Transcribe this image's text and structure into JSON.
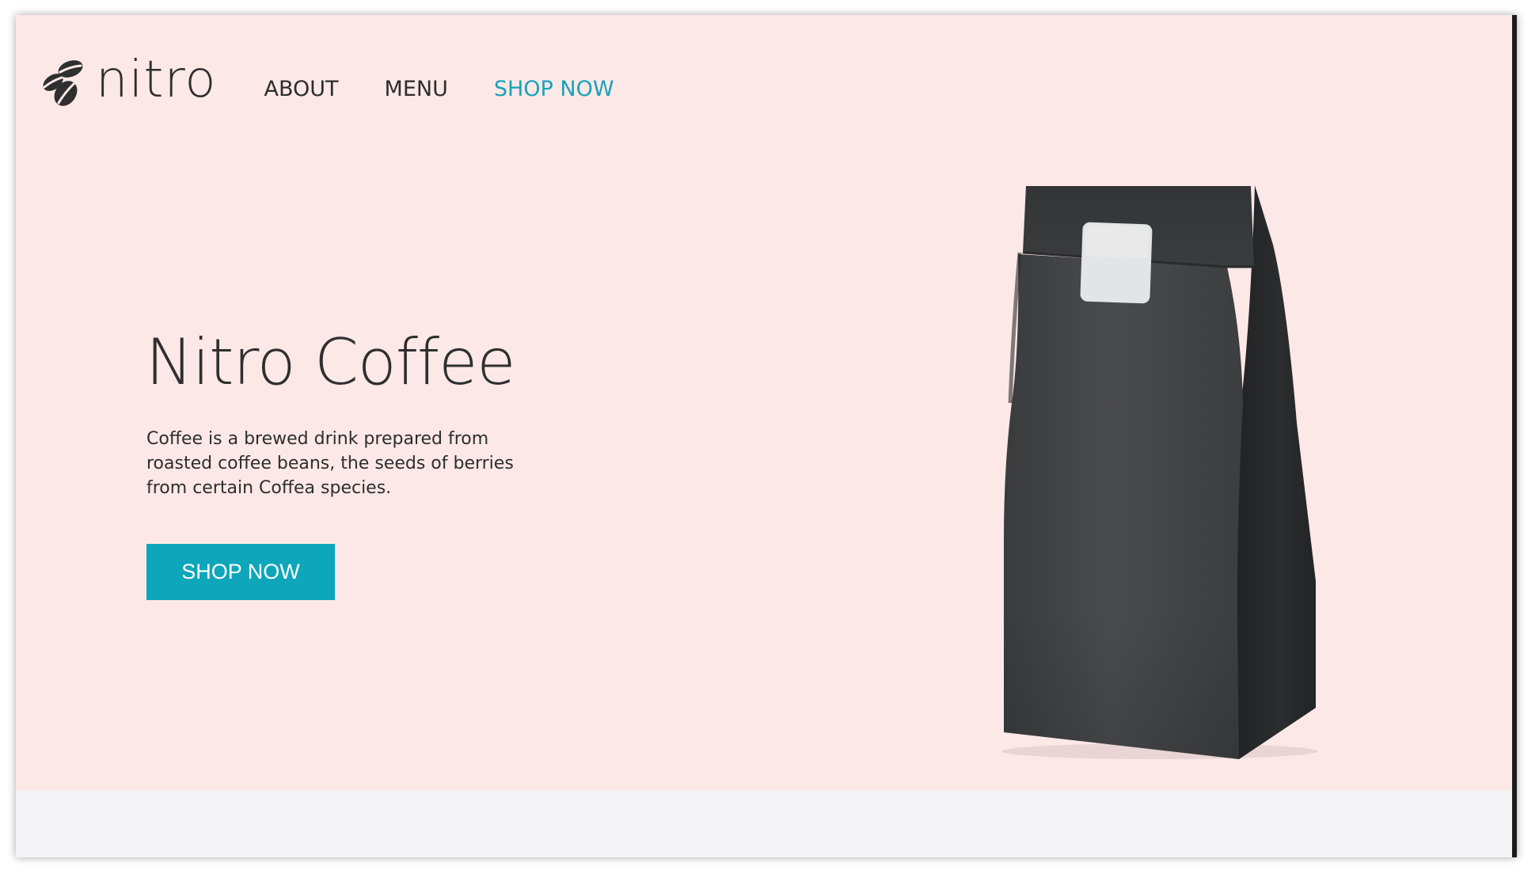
{
  "brand": {
    "name": "nitro",
    "logo_icon": "coffee-beans-icon"
  },
  "nav": {
    "items": [
      {
        "label": "ABOUT",
        "active": false
      },
      {
        "label": "MENU",
        "active": false
      },
      {
        "label": "SHOP NOW",
        "active": true
      }
    ]
  },
  "hero": {
    "title": "Nitro Coffee",
    "description": "Coffee is a brewed drink prepared from roasted coffee beans, the seeds of berries from certain Coffea species.",
    "button_label": "SHOP NOW",
    "product_image": "coffee-bag-image"
  },
  "colors": {
    "hero_background": "#fde8e8",
    "accent": "#0ea6bb",
    "text": "#2f2f2f",
    "footer_background": "#f4f3f5"
  }
}
